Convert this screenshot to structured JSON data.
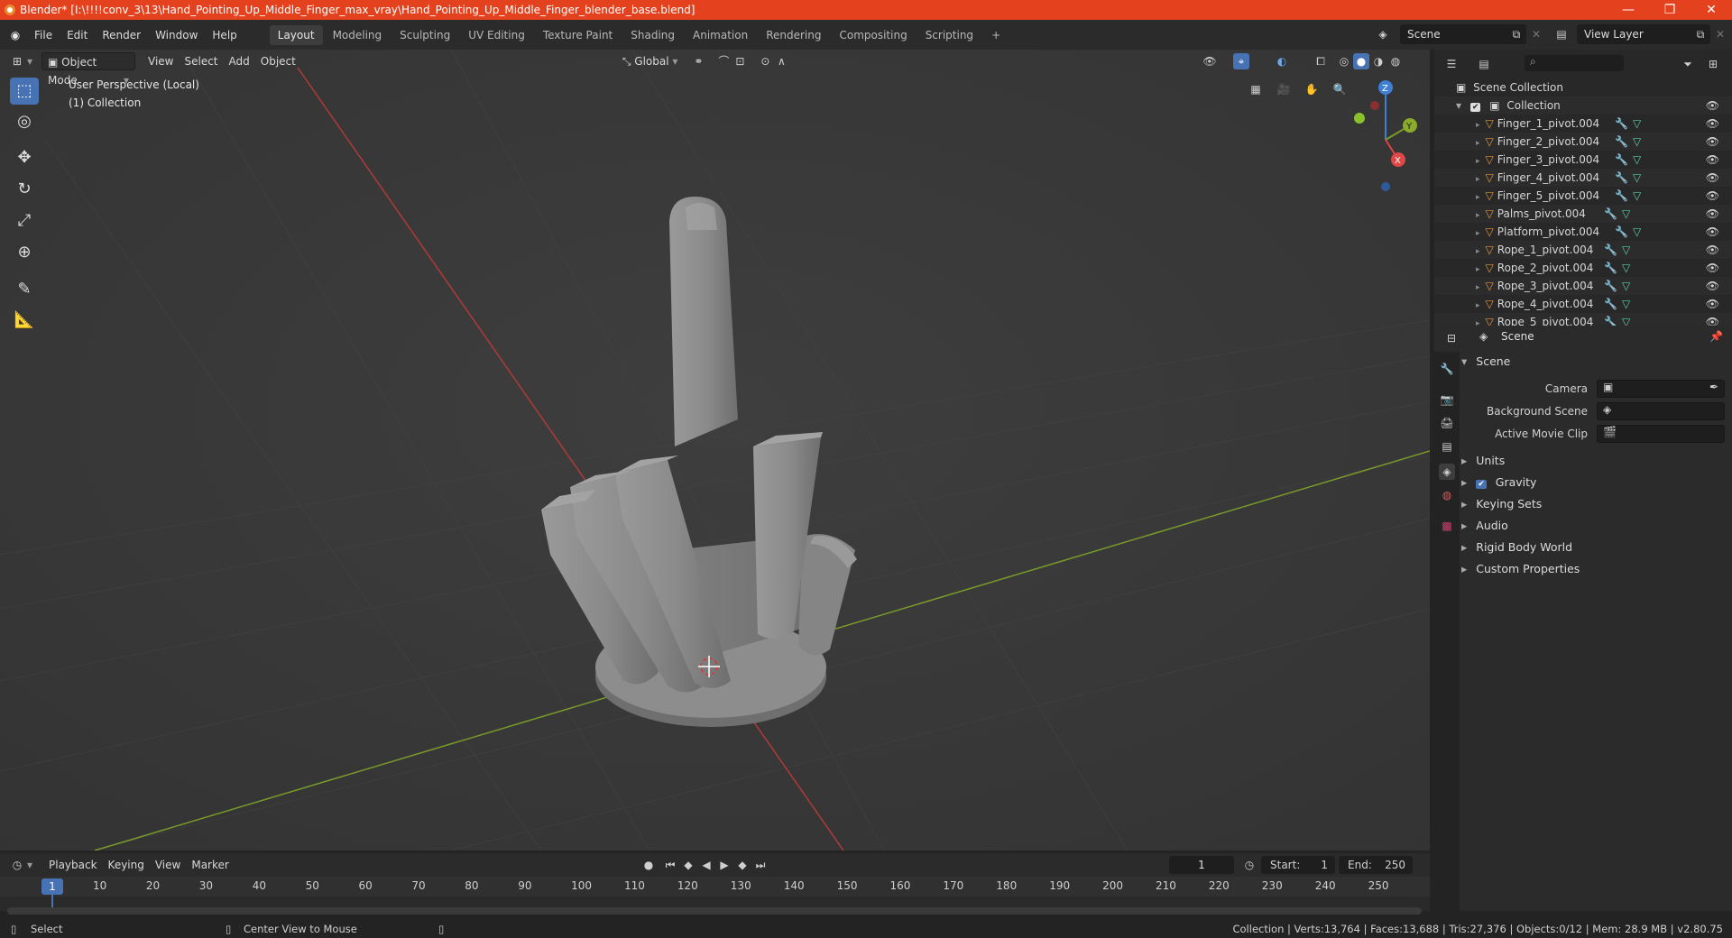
{
  "window": {
    "title": "Blender* [I:\\!!!!conv_3\\13\\Hand_Pointing_Up_Middle_Finger_max_vray\\Hand_Pointing_Up_Middle_Finger_blender_base.blend]",
    "minimize": "—",
    "maximize": "❐",
    "close": "✕"
  },
  "menu": [
    "File",
    "Edit",
    "Render",
    "Window",
    "Help"
  ],
  "workspaces": [
    "Layout",
    "Modeling",
    "Sculpting",
    "UV Editing",
    "Texture Paint",
    "Shading",
    "Animation",
    "Rendering",
    "Compositing",
    "Scripting"
  ],
  "add_workspace": "+",
  "scene_name": "Scene",
  "view_layer": "View Layer",
  "viewport": {
    "mode": "Object Mode",
    "menus": [
      "View",
      "Select",
      "Add",
      "Object"
    ],
    "orientation": "Global",
    "info_line1": "User Perspective (Local)",
    "info_line2": "(1) Collection",
    "gizmo": {
      "x": "X",
      "y": "Y",
      "z": "Z"
    }
  },
  "outliner": {
    "root": "Scene Collection",
    "collection": "Collection",
    "items": [
      "Finger_1_pivot.004",
      "Finger_2_pivot.004",
      "Finger_3_pivot.004",
      "Finger_4_pivot.004",
      "Finger_5_pivot.004",
      "Palms_pivot.004",
      "Platform_pivot.004",
      "Rope_1_pivot.004",
      "Rope_2_pivot.004",
      "Rope_3_pivot.004",
      "Rope_4_pivot.004",
      "Rope_5_pivot.004"
    ]
  },
  "properties": {
    "context": "Scene",
    "section": "Scene",
    "camera_label": "Camera",
    "background_scene_label": "Background Scene",
    "active_movie_clip_label": "Active Movie Clip",
    "panels": [
      "Units",
      "Gravity",
      "Keying Sets",
      "Audio",
      "Rigid Body World",
      "Custom Properties"
    ],
    "gravity_checked": true
  },
  "timeline": {
    "menus": [
      "Playback",
      "Keying",
      "View",
      "Marker"
    ],
    "current_frame": "1",
    "start_label": "Start:",
    "start": "1",
    "end_label": "End:",
    "end": "250",
    "ticks": [
      "10",
      "20",
      "30",
      "40",
      "50",
      "60",
      "70",
      "80",
      "90",
      "100",
      "110",
      "120",
      "130",
      "140",
      "150",
      "160",
      "170",
      "180",
      "190",
      "200",
      "210",
      "220",
      "230",
      "240",
      "250"
    ],
    "current_marker": "1"
  },
  "statusbar": {
    "left": "Select",
    "middle": "Center View to Mouse",
    "right": "Collection | Verts:13,764 | Faces:13,688 | Tris:27,376 | Objects:0/12 | Mem: 28.9 MB | v2.80.75"
  },
  "colors": {
    "titlebar": "#e4421e",
    "accent": "#4772b3",
    "x_axis": "#b03a3a",
    "y_axis": "#7a9a2a"
  }
}
